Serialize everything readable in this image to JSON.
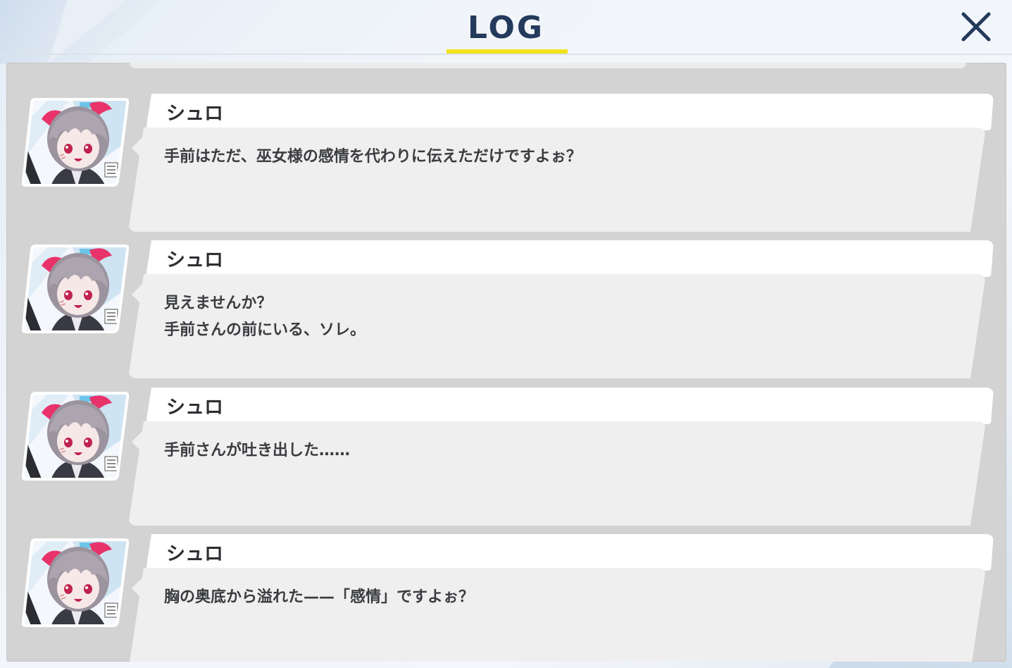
{
  "header": {
    "title": "LOG",
    "close_icon": "close-icon",
    "accent_color": "#f3e21b",
    "title_color": "#243a5c"
  },
  "log": {
    "entries": [
      {
        "speaker": "シュロ",
        "avatar_icon": "character-portrait-shuro",
        "text": "手前はただ、巫女様の感情を代わりに伝えただけですよぉ？"
      },
      {
        "speaker": "シュロ",
        "avatar_icon": "character-portrait-shuro",
        "text": "見えませんか？\n手前さんの前にいる、ソレ。"
      },
      {
        "speaker": "シュロ",
        "avatar_icon": "character-portrait-shuro",
        "text": "手前さんが吐き出した……"
      },
      {
        "speaker": "シュロ",
        "avatar_icon": "character-portrait-shuro",
        "text": "胸の奥底から溢れた——「感情」ですよぉ？"
      }
    ]
  }
}
